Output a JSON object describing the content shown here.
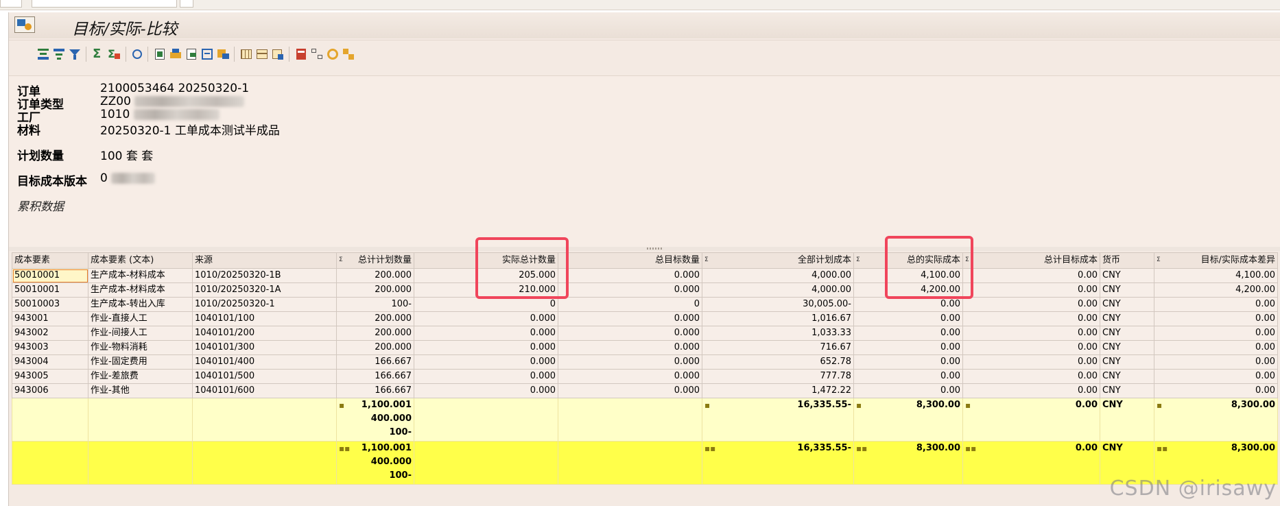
{
  "window": {
    "title": "目标/实际-比较"
  },
  "header": {
    "rows": [
      {
        "label": "订单",
        "value": "2100053464 20250320-1"
      },
      {
        "label": "订单类型",
        "value": "ZZ00"
      },
      {
        "label": "工厂",
        "value": "1010"
      },
      {
        "label": "材料",
        "value": "20250320-1 工单成本测试半成品"
      },
      {
        "label": "计划数量",
        "value": "100 套 套"
      },
      {
        "label": "目标成本版本",
        "value": "0"
      }
    ],
    "section_title": "累积数据"
  },
  "table": {
    "columns": [
      "成本要素",
      "成本要素 (文本)",
      "来源",
      "总计计划数量",
      "实际总计数量",
      "总目标数量",
      "全部计划成本",
      "总的实际成本",
      "总计目标成本",
      "货币",
      "目标/实际成本差异"
    ],
    "rows": [
      {
        "c0": "50010001",
        "c1": "生产成本-材料成本",
        "c2": "1010/20250320-1B",
        "c3": "200.000",
        "c4": "205.000",
        "c5": "0.000",
        "c6": "4,000.00",
        "c7": "4,100.00",
        "c8": "0.00",
        "c9": "CNY",
        "c10": "4,100.00"
      },
      {
        "c0": "50010001",
        "c1": "生产成本-材料成本",
        "c2": "1010/20250320-1A",
        "c3": "200.000",
        "c4": "210.000",
        "c5": "0.000",
        "c6": "4,000.00",
        "c7": "4,200.00",
        "c8": "0.00",
        "c9": "CNY",
        "c10": "4,200.00"
      },
      {
        "c0": "50010003",
        "c1": "生产成本-转出入库",
        "c2": "1010/20250320-1",
        "c3": "100-",
        "c4": "0",
        "c5": "0",
        "c6": "30,005.00-",
        "c7": "0.00",
        "c8": "0.00",
        "c9": "CNY",
        "c10": "0.00"
      },
      {
        "c0": "943001",
        "c1": "作业-直接人工",
        "c2": "1040101/100",
        "c3": "200.000",
        "c4": "0.000",
        "c5": "0.000",
        "c6": "1,016.67",
        "c7": "0.00",
        "c8": "0.00",
        "c9": "CNY",
        "c10": "0.00"
      },
      {
        "c0": "943002",
        "c1": "作业-间接人工",
        "c2": "1040101/200",
        "c3": "200.000",
        "c4": "0.000",
        "c5": "0.000",
        "c6": "1,033.33",
        "c7": "0.00",
        "c8": "0.00",
        "c9": "CNY",
        "c10": "0.00"
      },
      {
        "c0": "943003",
        "c1": "作业-物料消耗",
        "c2": "1040101/300",
        "c3": "200.000",
        "c4": "0.000",
        "c5": "0.000",
        "c6": "716.67",
        "c7": "0.00",
        "c8": "0.00",
        "c9": "CNY",
        "c10": "0.00"
      },
      {
        "c0": "943004",
        "c1": "作业-固定费用",
        "c2": "1040101/400",
        "c3": "166.667",
        "c4": "0.000",
        "c5": "0.000",
        "c6": "652.78",
        "c7": "0.00",
        "c8": "0.00",
        "c9": "CNY",
        "c10": "0.00"
      },
      {
        "c0": "943005",
        "c1": "作业-差旅费",
        "c2": "1040101/500",
        "c3": "166.667",
        "c4": "0.000",
        "c5": "0.000",
        "c6": "777.78",
        "c7": "0.00",
        "c8": "0.00",
        "c9": "CNY",
        "c10": "0.00"
      },
      {
        "c0": "943006",
        "c1": "作业-其他",
        "c2": "1040101/600",
        "c3": "166.667",
        "c4": "0.000",
        "c5": "0.000",
        "c6": "1,472.22",
        "c7": "0.00",
        "c8": "0.00",
        "c9": "CNY",
        "c10": "0.00"
      }
    ],
    "subtotal": {
      "qty_lines": [
        "1,100.001",
        "400.000",
        "100-"
      ],
      "plan_cost": "16,335.55-",
      "actual_cost": "8,300.00",
      "target_cost": "0.00",
      "currency": "CNY",
      "variance": "8,300.00"
    },
    "total": {
      "qty_lines": [
        "1,100.001",
        "400.000",
        "100-"
      ],
      "plan_cost": "16,335.55-",
      "actual_cost": "8,300.00",
      "target_cost": "0.00",
      "currency": "CNY",
      "variance": "8,300.00"
    },
    "sigma_glyph": "Σ",
    "sub_dot": "▪",
    "total_dot": "▪▪"
  },
  "watermark": "CSDN @irisawy",
  "colors": {
    "highlight": "#f0455b",
    "subtotal_bg": "#ffffc8",
    "total_bg": "#ffff4a"
  }
}
